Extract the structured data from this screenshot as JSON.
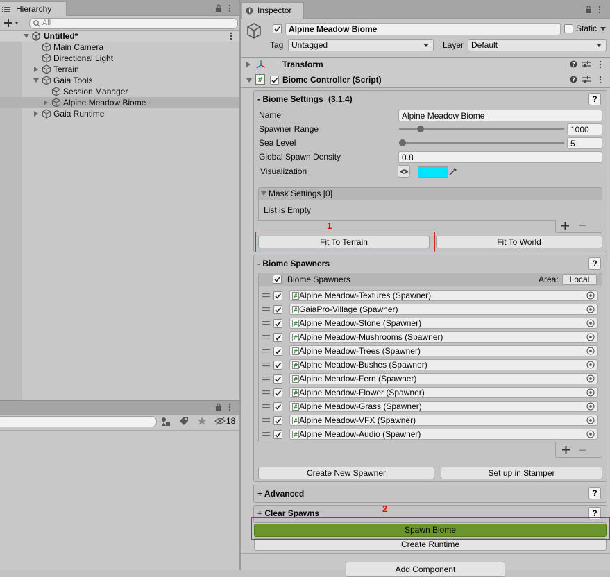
{
  "hierarchy": {
    "tab_label": "Hierarchy",
    "search_placeholder": "All",
    "scene_name": "Untitled*",
    "items": [
      {
        "label": "Main Camera"
      },
      {
        "label": "Directional Light"
      },
      {
        "label": "Terrain"
      },
      {
        "label": "Gaia Tools"
      },
      {
        "label": "Session Manager"
      },
      {
        "label": "Alpine Meadow Biome"
      },
      {
        "label": "Gaia Runtime"
      }
    ]
  },
  "project": {
    "hidden_count": "18"
  },
  "inspector": {
    "tab_label": "Inspector",
    "object_name": "Alpine Meadow Biome",
    "static_label": "Static",
    "tag_label": "Tag",
    "tag_value": "Untagged",
    "layer_label": "Layer",
    "layer_value": "Default",
    "transform_label": "Transform",
    "script_label": "Biome Controller (Script)"
  },
  "biome_settings": {
    "header": "- Biome Settings",
    "version": "(3.1.4)",
    "name_label": "Name",
    "name_value": "Alpine Meadow Biome",
    "range_label": "Spawner Range",
    "range_value": "1000",
    "range_fraction": 0.13,
    "sea_label": "Sea Level",
    "sea_value": "5",
    "sea_fraction": 0.0,
    "density_label": "Global Spawn Density",
    "density_value": "0.8",
    "vis_label": "Visualization",
    "vis_color": "#00e5ff",
    "mask_header": "Mask Settings [0]",
    "mask_empty": "List is Empty",
    "fit_terrain": "Fit To Terrain",
    "fit_world": "Fit To World"
  },
  "biome_spawners": {
    "header": "- Biome Spawners",
    "list_header": "Biome Spawners",
    "area_label": "Area:",
    "area_value": "Local",
    "items": [
      "Alpine Meadow-Textures (Spawner)",
      "GaiaPro-Village (Spawner)",
      "Alpine Meadow-Stone (Spawner)",
      "Alpine Meadow-Mushrooms (Spawner)",
      "Alpine Meadow-Trees (Spawner)",
      "Alpine Meadow-Bushes (Spawner)",
      "Alpine Meadow-Fern (Spawner)",
      "Alpine Meadow-Flower (Spawner)",
      "Alpine Meadow-Grass (Spawner)",
      "Alpine Meadow-VFX (Spawner)",
      "Alpine Meadow-Audio (Spawner)"
    ],
    "create_new": "Create New Spawner",
    "setup_stamper": "Set up in Stamper"
  },
  "advanced_header": "+ Advanced",
  "clear_spawns_header": "+ Clear Spawns",
  "spawn_biome": "Spawn Biome",
  "spawn_color": "#6b962f",
  "create_runtime": "Create Runtime",
  "add_component": "Add Component",
  "annotations": {
    "one": "1",
    "two": "2"
  }
}
